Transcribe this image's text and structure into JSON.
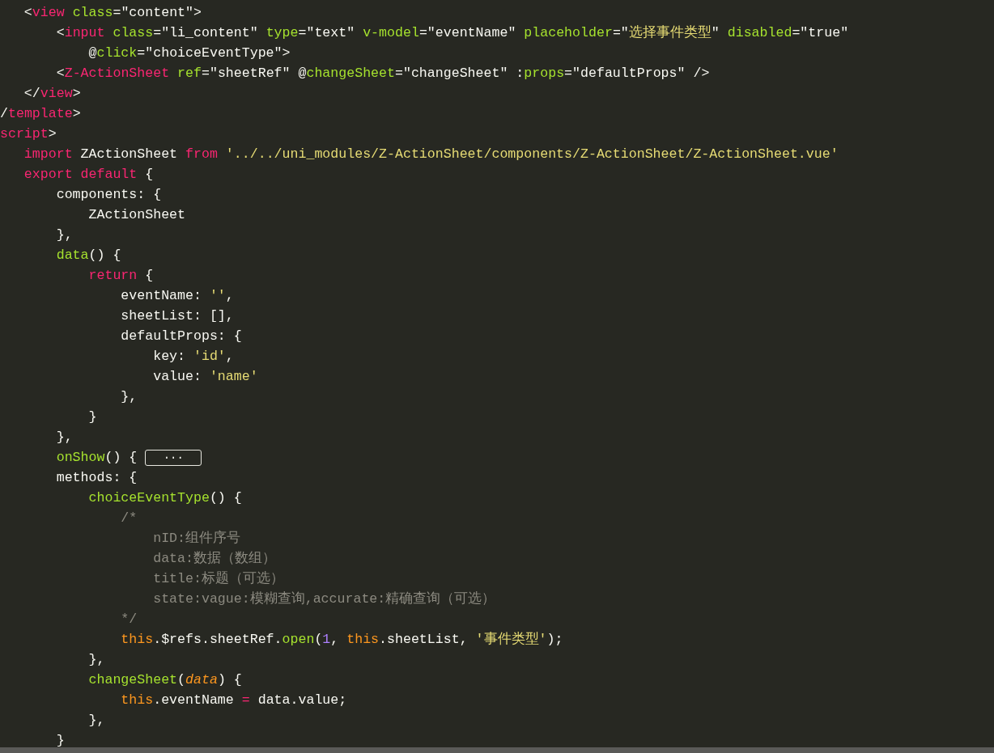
{
  "editor": {
    "lines": [
      {
        "tokens": [
          {
            "kind": "plain",
            "text": "   <"
          },
          {
            "kind": "tag",
            "text": "view"
          },
          {
            "kind": "attr",
            "text": " class"
          },
          {
            "kind": "plain",
            "text": "=\"content\">"
          }
        ]
      },
      {
        "tokens": [
          {
            "kind": "plain",
            "text": "       <"
          },
          {
            "kind": "tag",
            "text": "input"
          },
          {
            "kind": "attr",
            "text": " class"
          },
          {
            "kind": "plain",
            "text": "=\"li_content\" "
          },
          {
            "kind": "attr",
            "text": "type"
          },
          {
            "kind": "plain",
            "text": "=\"text\" "
          },
          {
            "kind": "attr",
            "text": "v-model"
          },
          {
            "kind": "plain",
            "text": "=\"eventName\" "
          },
          {
            "kind": "attr",
            "text": "placeholder"
          },
          {
            "kind": "plain",
            "text": "=\""
          },
          {
            "kind": "string",
            "text": "选择事件类型"
          },
          {
            "kind": "plain",
            "text": "\" "
          },
          {
            "kind": "attr",
            "text": "disabled"
          },
          {
            "kind": "plain",
            "text": "=\"true\""
          }
        ]
      },
      {
        "tokens": [
          {
            "kind": "plain",
            "text": "           @"
          },
          {
            "kind": "attr",
            "text": "click"
          },
          {
            "kind": "plain",
            "text": "=\"choiceEventType\">"
          }
        ]
      },
      {
        "tokens": [
          {
            "kind": "plain",
            "text": "       <"
          },
          {
            "kind": "tag",
            "text": "Z-ActionSheet"
          },
          {
            "kind": "attr",
            "text": " ref"
          },
          {
            "kind": "plain",
            "text": "=\"sheetRef\" @"
          },
          {
            "kind": "attr",
            "text": "changeSheet"
          },
          {
            "kind": "plain",
            "text": "=\"changeSheet\" :"
          },
          {
            "kind": "attr",
            "text": "props"
          },
          {
            "kind": "plain",
            "text": "=\"defaultProps\" />"
          }
        ]
      },
      {
        "tokens": [
          {
            "kind": "plain",
            "text": "   </"
          },
          {
            "kind": "tag",
            "text": "view"
          },
          {
            "kind": "plain",
            "text": ">"
          }
        ]
      },
      {
        "tokens": [
          {
            "kind": "plain",
            "text": "/"
          },
          {
            "kind": "tag",
            "text": "template"
          },
          {
            "kind": "plain",
            "text": ">"
          }
        ]
      },
      {
        "tokens": [
          {
            "kind": "tag",
            "text": "script"
          },
          {
            "kind": "plain",
            "text": ">"
          }
        ]
      },
      {
        "tokens": [
          {
            "kind": "keyword",
            "text": "   import"
          },
          {
            "kind": "plain",
            "text": " ZActionSheet "
          },
          {
            "kind": "keyword",
            "text": "from"
          },
          {
            "kind": "string",
            "text": " '../../uni_modules/Z-ActionSheet/components/Z-ActionSheet/Z-ActionSheet.vue'"
          }
        ]
      },
      {
        "tokens": [
          {
            "kind": "keyword",
            "text": "   export default"
          },
          {
            "kind": "plain",
            "text": " {"
          }
        ]
      },
      {
        "tokens": [
          {
            "kind": "plain",
            "text": "       components: {"
          }
        ]
      },
      {
        "tokens": [
          {
            "kind": "plain",
            "text": "           ZActionSheet"
          }
        ]
      },
      {
        "tokens": [
          {
            "kind": "plain",
            "text": "       },"
          }
        ]
      },
      {
        "tokens": [
          {
            "kind": "function",
            "text": "       data"
          },
          {
            "kind": "plain",
            "text": "() {"
          }
        ]
      },
      {
        "tokens": [
          {
            "kind": "keyword",
            "text": "           return"
          },
          {
            "kind": "plain",
            "text": " {"
          }
        ]
      },
      {
        "tokens": [
          {
            "kind": "plain",
            "text": "               eventName: "
          },
          {
            "kind": "string",
            "text": "''"
          },
          {
            "kind": "plain",
            "text": ","
          }
        ]
      },
      {
        "tokens": [
          {
            "kind": "plain",
            "text": "               sheetList: [],"
          }
        ]
      },
      {
        "tokens": [
          {
            "kind": "plain",
            "text": "               defaultProps: {"
          }
        ]
      },
      {
        "tokens": [
          {
            "kind": "plain",
            "text": "                   key: "
          },
          {
            "kind": "string",
            "text": "'id'"
          },
          {
            "kind": "plain",
            "text": ","
          }
        ]
      },
      {
        "tokens": [
          {
            "kind": "plain",
            "text": "                   value: "
          },
          {
            "kind": "string",
            "text": "'name'"
          }
        ]
      },
      {
        "tokens": [
          {
            "kind": "plain",
            "text": "               },"
          }
        ]
      },
      {
        "tokens": [
          {
            "kind": "plain",
            "text": "           }"
          }
        ]
      },
      {
        "tokens": [
          {
            "kind": "plain",
            "text": "       },"
          }
        ]
      },
      {
        "tokens": [
          {
            "kind": "function",
            "text": "       onShow"
          },
          {
            "kind": "plain",
            "text": "() {"
          }
        ],
        "fold": "···"
      },
      {
        "tokens": [
          {
            "kind": "plain",
            "text": "       methods: {"
          }
        ]
      },
      {
        "tokens": [
          {
            "kind": "function",
            "text": "           choiceEventType"
          },
          {
            "kind": "plain",
            "text": "() {"
          }
        ]
      },
      {
        "tokens": [
          {
            "kind": "comment",
            "text": "               /*"
          }
        ]
      },
      {
        "tokens": [
          {
            "kind": "comment",
            "text": "                   nID:组件序号"
          }
        ]
      },
      {
        "tokens": [
          {
            "kind": "comment",
            "text": "                   data:数据（数组）"
          }
        ]
      },
      {
        "tokens": [
          {
            "kind": "comment",
            "text": "                   title:标题（可选）"
          }
        ]
      },
      {
        "tokens": [
          {
            "kind": "comment",
            "text": "                   state:vague:模糊查询,accurate:精确查询（可选）"
          }
        ]
      },
      {
        "tokens": [
          {
            "kind": "comment",
            "text": "               */"
          }
        ]
      },
      {
        "tokens": [
          {
            "kind": "this",
            "text": "               this"
          },
          {
            "kind": "plain",
            "text": ".$refs.sheetRef."
          },
          {
            "kind": "function",
            "text": "open"
          },
          {
            "kind": "plain",
            "text": "("
          },
          {
            "kind": "number",
            "text": "1"
          },
          {
            "kind": "plain",
            "text": ", "
          },
          {
            "kind": "this",
            "text": "this"
          },
          {
            "kind": "plain",
            "text": ".sheetList, "
          },
          {
            "kind": "string",
            "text": "'事件类型'"
          },
          {
            "kind": "plain",
            "text": ");"
          }
        ]
      },
      {
        "tokens": [
          {
            "kind": "plain",
            "text": "           },"
          }
        ]
      },
      {
        "tokens": [
          {
            "kind": "function",
            "text": "           changeSheet"
          },
          {
            "kind": "plain",
            "text": "("
          },
          {
            "kind": "param",
            "text": "data"
          },
          {
            "kind": "plain",
            "text": ") {"
          }
        ]
      },
      {
        "tokens": [
          {
            "kind": "this",
            "text": "               this"
          },
          {
            "kind": "plain",
            "text": ".eventName "
          },
          {
            "kind": "operator",
            "text": "="
          },
          {
            "kind": "plain",
            "text": " data.value;"
          }
        ]
      },
      {
        "tokens": [
          {
            "kind": "plain",
            "text": "           },"
          }
        ]
      },
      {
        "tokens": [
          {
            "kind": "plain",
            "text": "       }"
          }
        ]
      }
    ]
  }
}
